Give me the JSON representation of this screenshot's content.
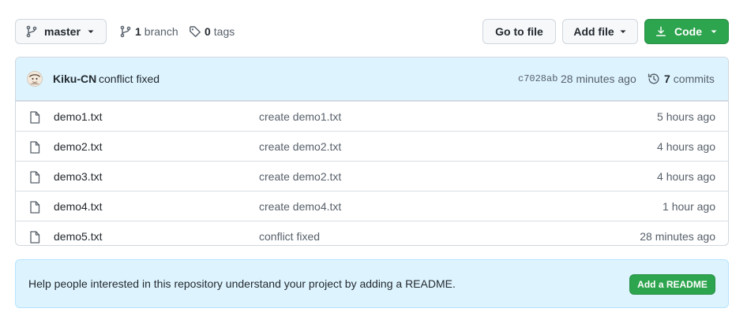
{
  "toolbar": {
    "branch_label": "master",
    "branch_count": "1",
    "branch_word": "branch",
    "tag_count": "0",
    "tag_word": "tags",
    "goto_file_label": "Go to file",
    "add_file_label": "Add file",
    "code_label": "Code"
  },
  "latest_commit": {
    "author": "Kiku-CN",
    "message": "conflict fixed",
    "sha": "c7028ab",
    "time": "28 minutes ago",
    "commit_count": "7",
    "commits_word": "commits"
  },
  "files": [
    {
      "name": "demo1.txt",
      "message": "create demo1.txt",
      "time": "5 hours ago"
    },
    {
      "name": "demo2.txt",
      "message": "create demo2.txt",
      "time": "4 hours ago"
    },
    {
      "name": "demo3.txt",
      "message": "create demo2.txt",
      "time": "4 hours ago"
    },
    {
      "name": "demo4.txt",
      "message": "create demo4.txt",
      "time": "1 hour ago"
    },
    {
      "name": "demo5.txt",
      "message": "conflict fixed",
      "time": "28 minutes ago"
    }
  ],
  "readme": {
    "text": "Help people interested in this repository understand your project by adding a README.",
    "button_label": "Add a README"
  },
  "icons": {
    "branch": "git-branch-icon",
    "tag": "tag-icon",
    "download": "download-icon",
    "history": "history-icon",
    "file": "file-icon",
    "caret": "caret-down-icon"
  },
  "colors": {
    "primary_green": "#2da44e",
    "header_blue": "#ddf4ff",
    "border": "#d0d7de",
    "muted_text": "#57606a"
  }
}
